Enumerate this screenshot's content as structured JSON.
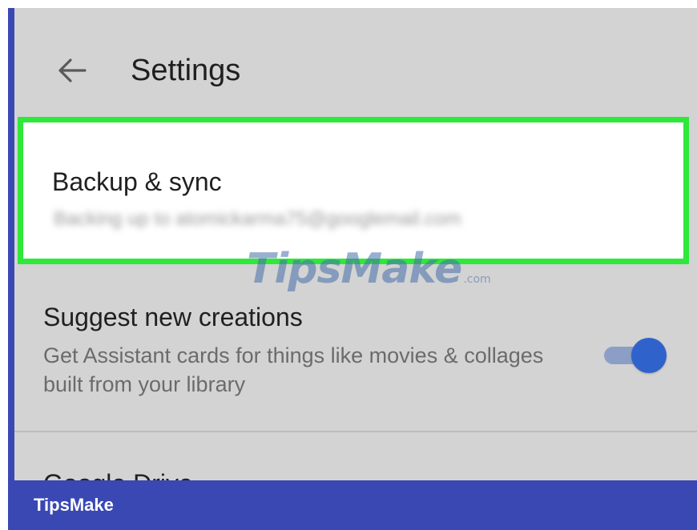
{
  "header": {
    "back_icon": "arrow-left-icon",
    "title": "Settings"
  },
  "settings": {
    "backup": {
      "title": "Backup & sync",
      "subtitle": "Backing up to atomickarma75@googlemail.com"
    },
    "suggest": {
      "title": "Suggest new creations",
      "description": "Get Assistant cards for things like movies & collages built from your library",
      "toggle_on": true
    },
    "drive": {
      "title": "Google Drive"
    }
  },
  "watermark": {
    "text": "TipsMake",
    "suffix": ".com"
  },
  "footer": {
    "label": "TipsMake"
  },
  "colors": {
    "highlight": "#2ee83a",
    "frame": "#3a48b4",
    "toggle_thumb": "#2f63cb",
    "toggle_track": "#8b9fc6"
  }
}
